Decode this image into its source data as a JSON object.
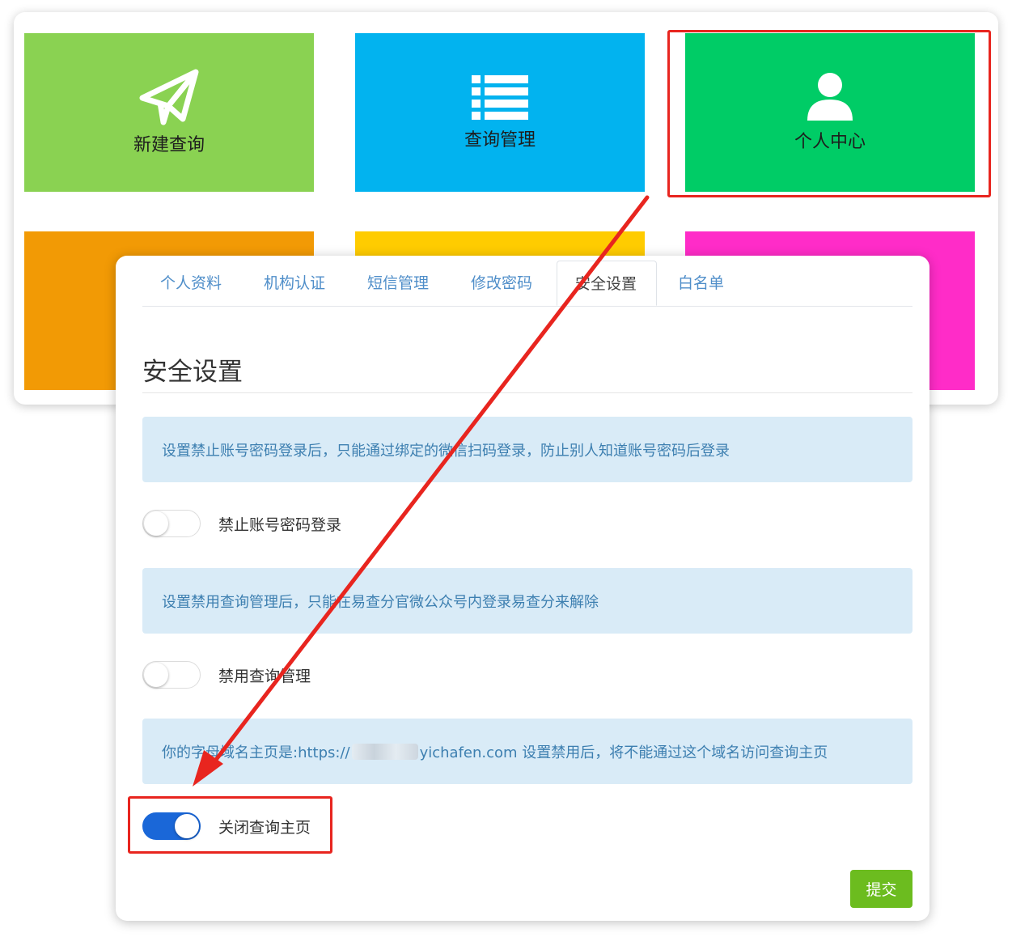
{
  "tiles": [
    {
      "label": "新建查询",
      "color": "#8ad252",
      "icon": "paper-plane-icon"
    },
    {
      "label": "查询管理",
      "color": "#02b3ef",
      "icon": "list-icon"
    },
    {
      "label": "个人中心",
      "color": "#00cc66",
      "icon": "user-icon"
    },
    {
      "label": "",
      "color": "#f29a05",
      "icon": ""
    },
    {
      "label": "",
      "color": "#ffcc00",
      "icon": ""
    },
    {
      "label": "",
      "color": "#ff2cc8",
      "icon": ""
    }
  ],
  "tabs": [
    {
      "label": "个人资料",
      "active": false
    },
    {
      "label": "机构认证",
      "active": false
    },
    {
      "label": "短信管理",
      "active": false
    },
    {
      "label": "修改密码",
      "active": false
    },
    {
      "label": "安全设置",
      "active": true
    },
    {
      "label": "白名单",
      "active": false
    }
  ],
  "section_title": "安全设置",
  "settings": [
    {
      "info": "设置禁止账号密码登录后，只能通过绑定的微信扫码登录，防止别人知道账号密码后登录",
      "label": "禁止账号密码登录",
      "on": false
    },
    {
      "info": "设置禁用查询管理后，只能在易查分官微公众号内登录易查分来解除",
      "label": "禁用查询管理",
      "on": false
    },
    {
      "info_prefix": "你的字母域名主页是:https://",
      "info_suffix": "yichafen.com 设置禁用后，将不能通过这个域名访问查询主页",
      "label": "关闭查询主页",
      "on": true
    }
  ],
  "submit_label": "提交",
  "colors": {
    "annotation": "#e8251f",
    "switch_on": "#1a67d8",
    "submit": "#6cbc1f",
    "alert_bg": "#d9ebf7",
    "alert_text": "#3d7fb0"
  }
}
